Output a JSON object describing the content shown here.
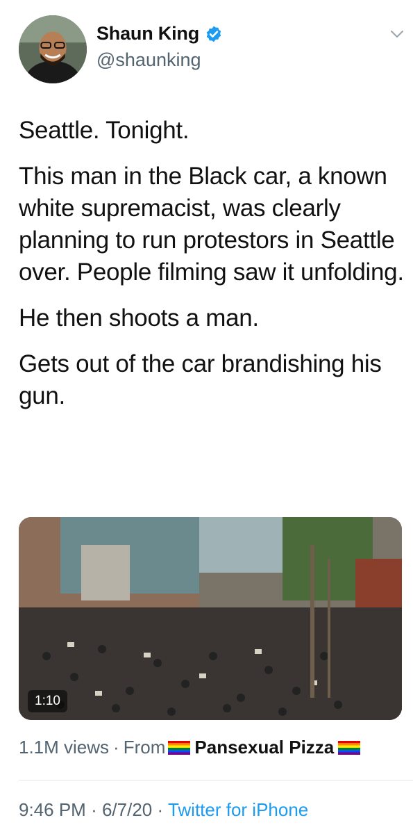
{
  "author": {
    "display_name": "Shaun King",
    "handle": "@shaunking",
    "verified": true,
    "avatar_icon": "profile-photo"
  },
  "tweet": {
    "paragraphs": [
      "Seattle. Tonight.",
      "This man in the Black car, a known white supremacist, was clearly planning to run protestors in Seattle over. People filming saw it unfolding.",
      "He then shoots a man.",
      "Gets out of the car brandishing his gun."
    ]
  },
  "media": {
    "duration": "1:10",
    "image_icon": "video-thumbnail-crowd"
  },
  "meta": {
    "views": "1.1M views",
    "separator": "·",
    "from_label": "From",
    "source_name": "Pansexual Pizza",
    "flag_icon": "rainbow-flag-icon"
  },
  "timestamp": {
    "time": "9:46 PM",
    "date": "6/7/20",
    "separator": "·",
    "client": "Twitter for iPhone"
  },
  "colors": {
    "accent": "#1d9bf0",
    "secondary_text": "#536471",
    "primary_text": "#111111"
  }
}
